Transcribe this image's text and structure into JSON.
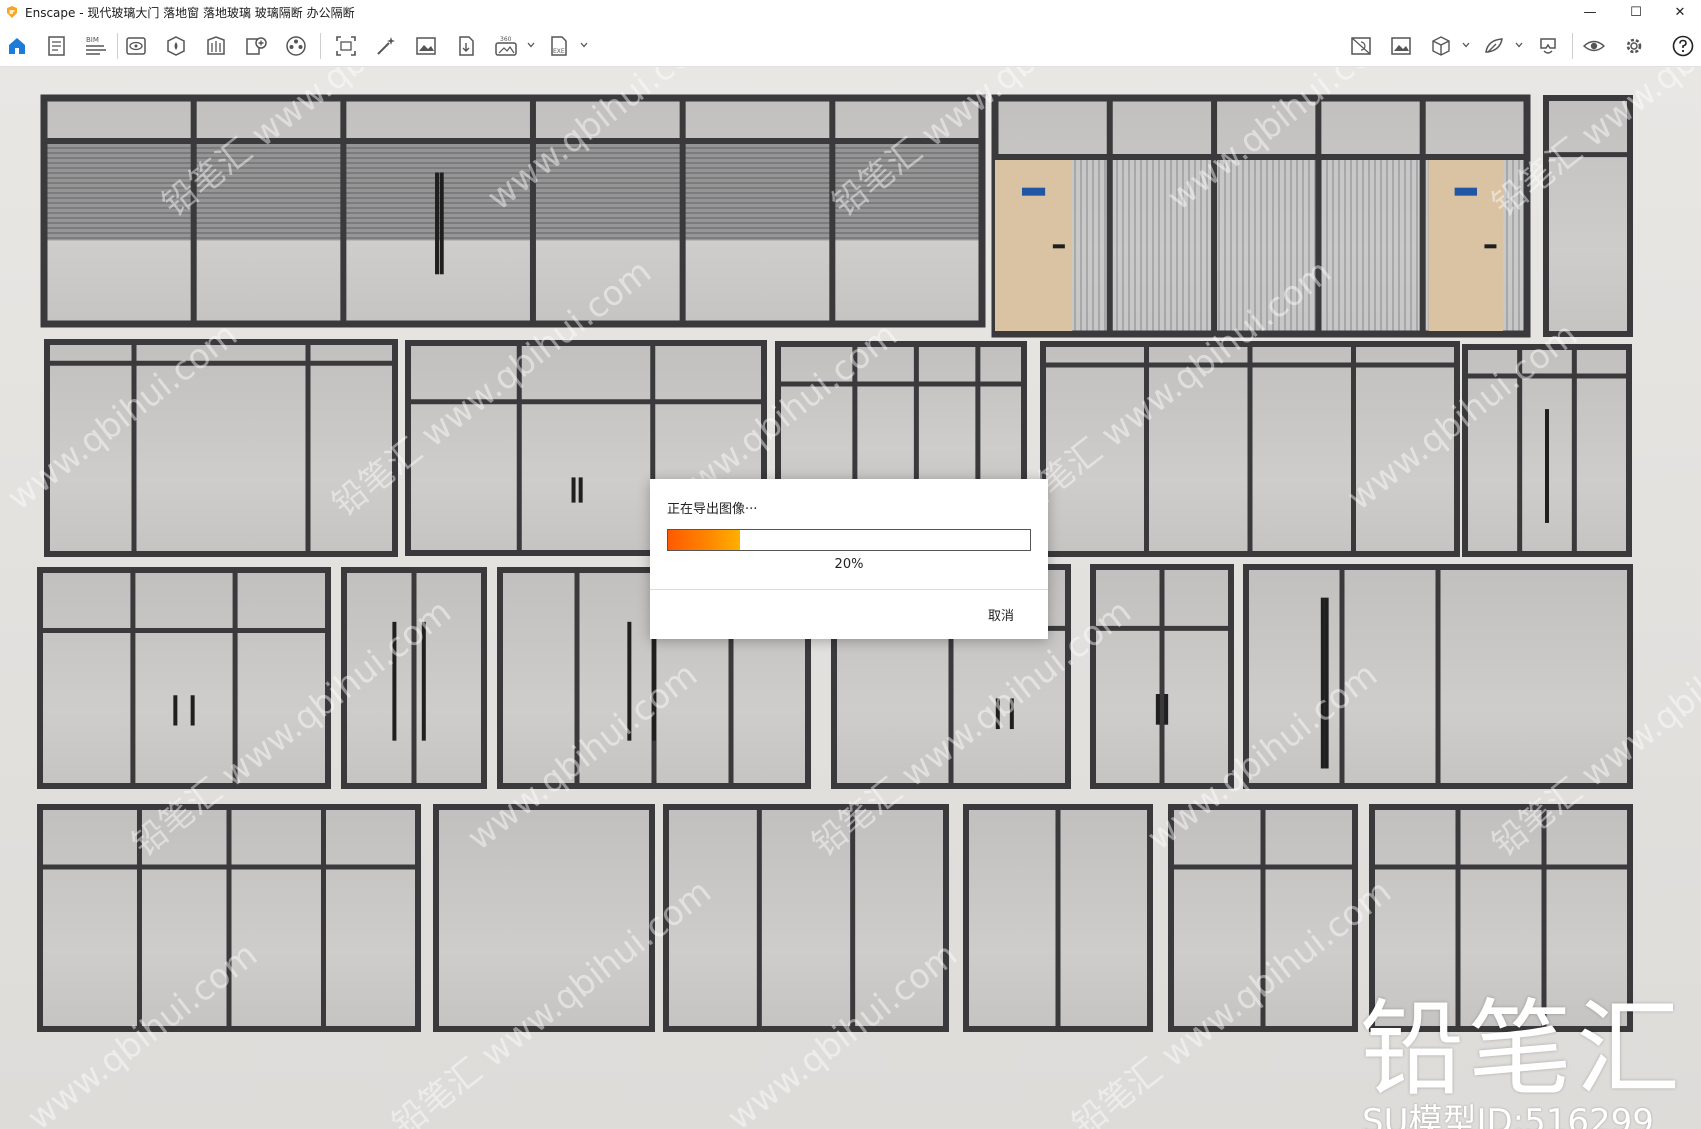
{
  "window": {
    "title": "Enscape - 现代玻璃大门 落地窗 落地玻璃 玻璃隔断 办公隔断",
    "minimize_glyph": "—",
    "maximize_glyph": "☐",
    "close_glyph": "✕"
  },
  "toolbar": {
    "left_icons": [
      "home-icon",
      "notes-icon",
      "bim-icon",
      "visual-settings-icon",
      "asset-library-icon",
      "material-editor-icon",
      "views-icon",
      "video-editor-icon",
      "screenshot-icon",
      "magic-wand-icon",
      "render-image-icon",
      "export-file-icon",
      "panorama-360-icon",
      "export-exe-icon"
    ],
    "right_icons": [
      "site-context-icon",
      "image-gallery-icon",
      "cube-view-icon",
      "feedback-icon",
      "vr-headset-icon",
      "eye-icon",
      "settings-icon",
      "help-icon"
    ],
    "bim_label": "BIM",
    "pano_label": "360",
    "exe_label": "EXE"
  },
  "dialog": {
    "message": "正在导出图像···",
    "progress_fraction": 0.2,
    "progress_text": "20%",
    "cancel_label": "取消"
  },
  "watermark": {
    "brand": "铅笔汇",
    "model_id": "SU模型ID:516299",
    "diagonal_text": "www.qbihui.com",
    "diagonal_brand": "铅笔汇"
  },
  "colors": {
    "accent": "#1e7bd8",
    "progress_start": "#ff5a00",
    "progress_end": "#ffb000",
    "frame": "#3a3a3c",
    "glass": "#c9c7c5"
  }
}
